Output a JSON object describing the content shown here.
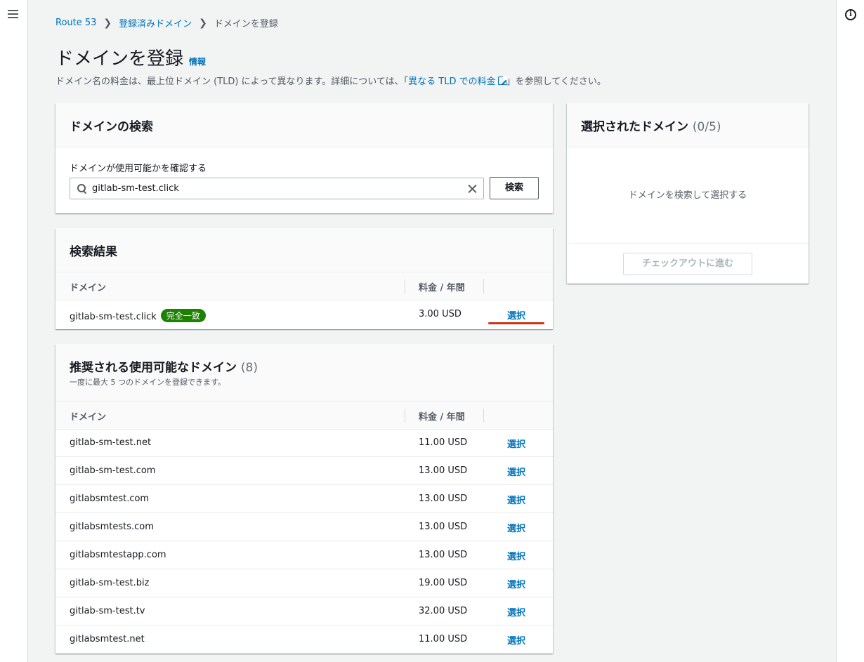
{
  "breadcrumb": {
    "items": [
      "Route 53",
      "登録済みドメイン"
    ],
    "current": "ドメインを登録"
  },
  "page": {
    "title": "ドメインを登録",
    "info_link": "情報",
    "description_pre": "ドメイン名の料金は、最上位ドメイン (TLD) によって異なります。詳細については、「",
    "description_link": "異なる TLD での料金",
    "description_post": "」を参照してください。"
  },
  "search": {
    "title": "ドメインの検索",
    "field_label": "ドメインが使用可能かを確認する",
    "value": "gitlab-sm-test.click",
    "button": "検索"
  },
  "results": {
    "title": "検索結果",
    "columns": [
      "ドメイン",
      "料金 / 年間"
    ],
    "rows": [
      {
        "domain": "gitlab-sm-test.click",
        "badge": "完全一致",
        "price": "3.00 USD",
        "action": "選択"
      }
    ]
  },
  "suggestions": {
    "title": "推奨される使用可能なドメイン",
    "count": "(8)",
    "subtitle": "一度に最大 5 つのドメインを登録できます。",
    "columns": [
      "ドメイン",
      "料金 / 年間"
    ],
    "rows": [
      {
        "domain": "gitlab-sm-test.net",
        "price": "11.00 USD",
        "action": "選択"
      },
      {
        "domain": "gitlab-sm-test.com",
        "price": "13.00 USD",
        "action": "選択"
      },
      {
        "domain": "gitlabsmtest.com",
        "price": "13.00 USD",
        "action": "選択"
      },
      {
        "domain": "gitlabsmtests.com",
        "price": "13.00 USD",
        "action": "選択"
      },
      {
        "domain": "gitlabsmtestapp.com",
        "price": "13.00 USD",
        "action": "選択"
      },
      {
        "domain": "gitlab-sm-test.biz",
        "price": "19.00 USD",
        "action": "選択"
      },
      {
        "domain": "gitlab-sm-test.tv",
        "price": "32.00 USD",
        "action": "選択"
      },
      {
        "domain": "gitlabsmtest.net",
        "price": "11.00 USD",
        "action": "選択"
      }
    ]
  },
  "selected": {
    "title": "選択されたドメイン",
    "count": "(0/5)",
    "empty_message": "ドメインを検索して選択する",
    "checkout_button": "チェックアウトに進む"
  },
  "colors": {
    "link": "#0073bb",
    "badge_success": "#1d8102",
    "annotation_underline": "#d13212"
  },
  "icons": [
    "menu-icon",
    "info-icon",
    "chevron-right-icon",
    "external-link-icon",
    "search-icon",
    "clear-icon"
  ]
}
